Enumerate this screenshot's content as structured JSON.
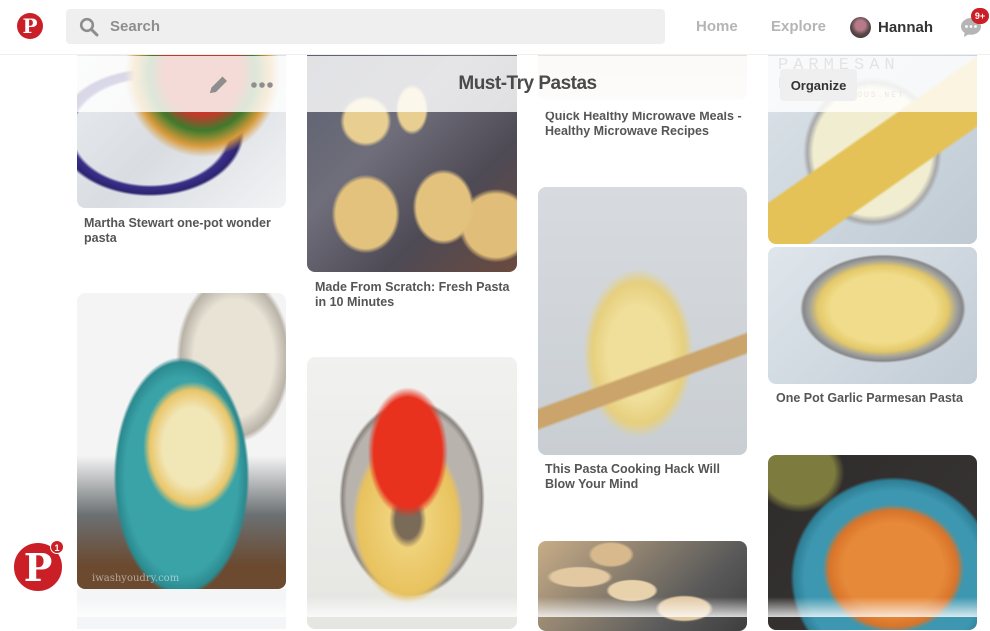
{
  "header": {
    "logo_glyph": "P",
    "search_placeholder": "Search",
    "nav": {
      "home": "Home",
      "explore": "Explore"
    },
    "user_name": "Hannah",
    "messages_badge": "9+"
  },
  "board": {
    "title": "Must-Try Pastas",
    "organize_label": "Organize",
    "watermark_line1": "PARMESAN PASTA",
    "watermark_line2": "LICIOUS.NET"
  },
  "pins": [
    {
      "title": "Martha Stewart one-pot wonder pasta"
    },
    {
      "title": "Made From Scratch: Fresh Pasta in 10 Minutes"
    },
    {
      "title": "Quick Healthy Microwave Meals - Healthy Microwave Recipes"
    },
    {
      "title": "One Pot Garlic Parmesan Pasta"
    },
    {
      "title": "This Pasta Cooking Hack Will Blow Your Mind"
    },
    {
      "title": "",
      "watermark": "iwashyoudry.com"
    },
    {
      "title": ""
    },
    {
      "title": ""
    },
    {
      "title": ""
    }
  ],
  "floating": {
    "logo_glyph": "P",
    "badge": "1"
  },
  "colors": {
    "brand_red": "#cb1f27",
    "text_dark": "#333333",
    "text_muted": "#b5b5b5",
    "search_bg": "#efefef"
  }
}
